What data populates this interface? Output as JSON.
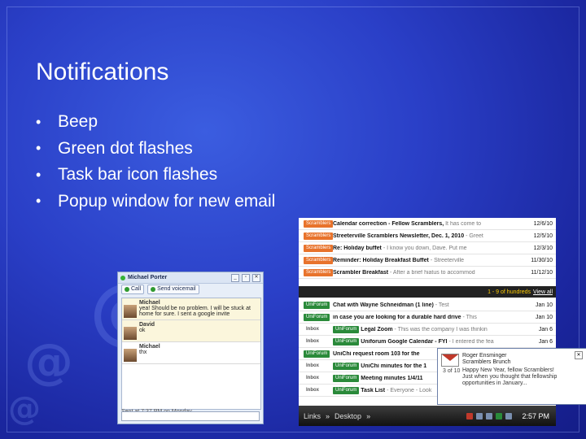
{
  "slide": {
    "title": "Notifications",
    "bullets": [
      "Beep",
      "Green dot flashes",
      "Task bar icon flashes",
      "Popup window for new email"
    ]
  },
  "chat": {
    "contact": "Michael Porter",
    "call_label": "Call",
    "voicemail_label": "Send voicemail",
    "messages": [
      {
        "name": "Michael",
        "text": "yea! Should be no problem. I will be stuck at home for sure. I sent a google invite"
      },
      {
        "name": "David",
        "text": "ok"
      },
      {
        "name": "Michael",
        "text": "thx"
      }
    ],
    "sent_at": "Sent at 7:37 PM on Monday"
  },
  "inbox": {
    "rows_top": [
      {
        "tag": "Scramblers",
        "subject": "Calendar correction - Fellow Scramblers,",
        "snippet": "It has come to",
        "date": "12/6/10"
      },
      {
        "tag": "Scramblers",
        "subject": "Streeterville Scramblers Newsletter, Dec. 1, 2010",
        "snippet": "- Greet",
        "date": "12/5/10"
      },
      {
        "tag": "Scramblers",
        "subject": "Re: Holiday buffet",
        "snippet": "- I know you down, Dave. Put me",
        "date": "12/3/10"
      },
      {
        "tag": "Scramblers",
        "subject": "Reminder: Holiday Breakfast Buffet",
        "snippet": "- Streeterville",
        "date": "11/30/10"
      },
      {
        "tag": "Scramblers",
        "subject": "Scrambler Breakfast",
        "snippet": "- After a brief hiatus to accommod",
        "date": "11/12/10"
      }
    ],
    "pager_text": "1 - 9 of hundreds",
    "view_all": "View all",
    "rows_bottom": [
      {
        "label": "",
        "tag": "UniForum",
        "subject": "Chat with Wayne Schneidman (1 line)",
        "snippet": "- Test",
        "date": "Jan 10"
      },
      {
        "label": "",
        "tag": "UniForum",
        "subject": "in case you are looking for a durable hard drive",
        "snippet": "- This",
        "date": "Jan 10"
      },
      {
        "label": "Inbox",
        "tag": "UniForum",
        "subject": "Legal Zoom",
        "snippet": "- This was the company I was thinkin",
        "date": "Jan 6"
      },
      {
        "label": "Inbox",
        "tag": "UniForum",
        "subject": "Uniforum Google Calendar - FYI",
        "snippet": "- I entered the fea",
        "date": "Jan 6"
      },
      {
        "label": "",
        "tag": "UniForum",
        "subject": "UniChi request room 103 for the",
        "snippet": "",
        "date": ""
      },
      {
        "label": "Inbox",
        "tag": "UniForum",
        "subject": "UniChi minutes for the 1",
        "snippet": "",
        "date": ""
      },
      {
        "label": "Inbox",
        "tag": "UniForum",
        "subject": "Meeting minutes 1/4/11",
        "snippet": "",
        "date": ""
      },
      {
        "label": "Inbox",
        "tag": "UniForum",
        "subject": "Task List",
        "snippet": "- Everyone - Look",
        "date": ""
      }
    ]
  },
  "popup": {
    "count": "3 of 10",
    "from": "Roger Ensminger",
    "subject": "Scramblers Brunch",
    "body": "Happy New Year, fellow Scramblers! Just when you thought that fellowship opportunities in January..."
  },
  "taskbar": {
    "links": "Links",
    "desktop": "Desktop",
    "clock": "2:57 PM"
  }
}
